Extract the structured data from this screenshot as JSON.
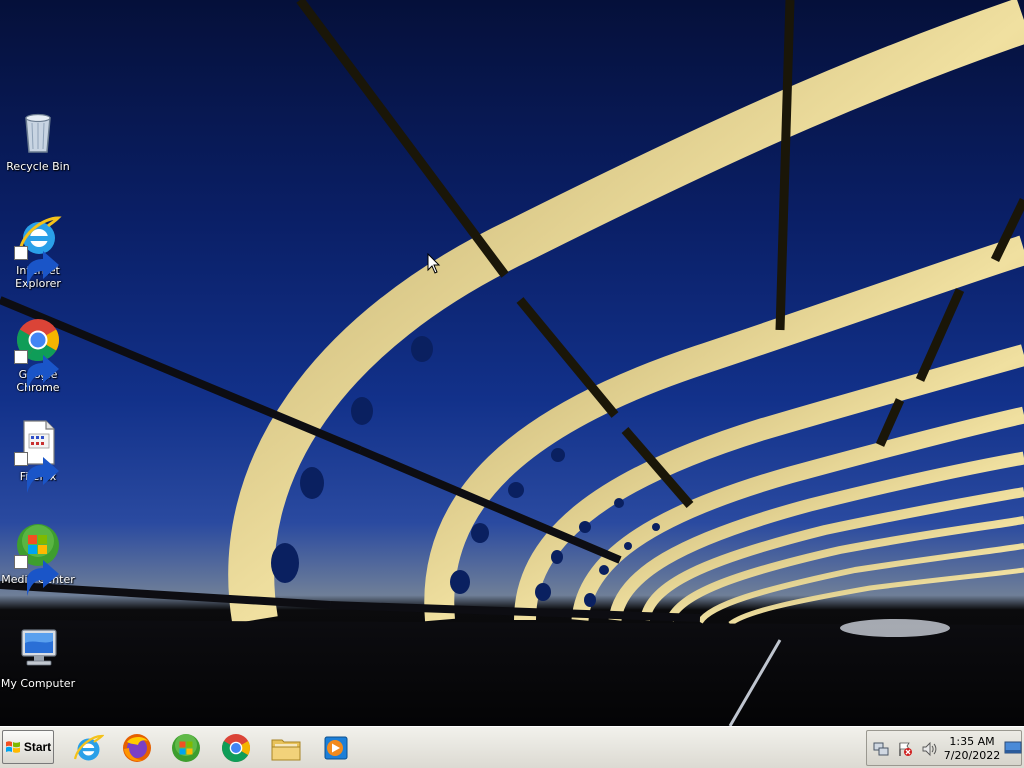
{
  "desktop": {
    "icons": [
      {
        "label": "Recycle Bin",
        "icon": "recycle-bin-icon"
      },
      {
        "label": "Internet Explorer",
        "icon": "internet-explorer-icon"
      },
      {
        "label": "Google Chrome",
        "icon": "google-chrome-icon"
      },
      {
        "label": "Firefox",
        "icon": "firefox-icon"
      },
      {
        "label": "Media Center",
        "icon": "media-center-icon"
      },
      {
        "label": "My Computer",
        "icon": "my-computer-icon"
      }
    ]
  },
  "taskbar": {
    "start_label": "Start",
    "quick_launch": [
      {
        "icon": "internet-explorer-icon"
      },
      {
        "icon": "firefox-icon"
      },
      {
        "icon": "windows-media-center-icon"
      },
      {
        "icon": "google-chrome-icon"
      },
      {
        "icon": "file-explorer-icon"
      },
      {
        "icon": "media-player-icon"
      }
    ],
    "tray": {
      "icons": [
        "network-icon",
        "action-center-flag-icon",
        "volume-icon"
      ],
      "time": "1:35 AM",
      "date": "7/20/2022"
    }
  },
  "colors": {
    "sky_top": "#05103a",
    "sky_mid": "#12318a",
    "arch": "#e9d690",
    "taskbar": "#dcdad2"
  }
}
